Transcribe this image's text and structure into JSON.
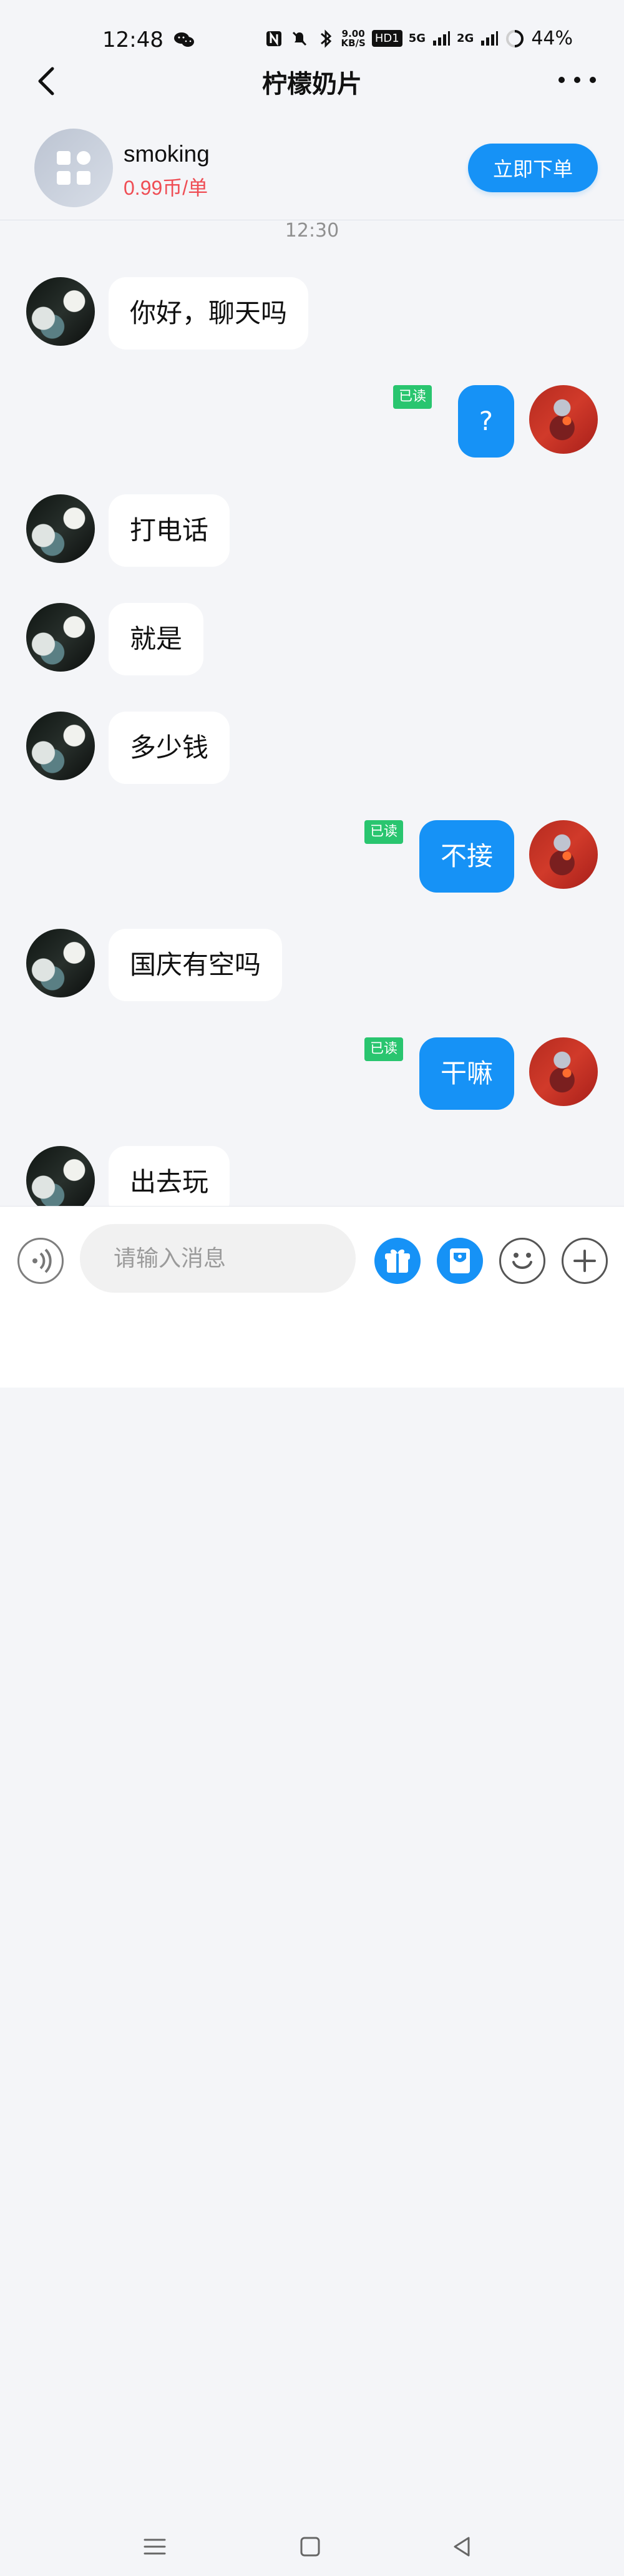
{
  "status": {
    "time": "12:48",
    "network_speed": "9.00",
    "network_unit": "KB/S",
    "hd": "HD1",
    "signal_1": "5G",
    "signal_2": "2G",
    "battery": "44%"
  },
  "header": {
    "title": "柠檬奶片"
  },
  "order": {
    "name": "smoking",
    "price": "0.99币/单",
    "button": "立即下单"
  },
  "chat": {
    "time": "12:30",
    "messages": [
      {
        "side": "left",
        "text": "你好，聊天吗"
      },
      {
        "side": "right",
        "text": "?",
        "read": "已读"
      },
      {
        "side": "left",
        "text": "打电话"
      },
      {
        "side": "left",
        "text": "就是"
      },
      {
        "side": "left",
        "text": "多少钱"
      },
      {
        "side": "right",
        "text": "不接",
        "read": "已读"
      },
      {
        "side": "left",
        "text": "国庆有空吗"
      },
      {
        "side": "right",
        "text": "干嘛",
        "read": "已读"
      },
      {
        "side": "left",
        "text": "出去玩"
      }
    ]
  },
  "input": {
    "placeholder": "请输入消息"
  },
  "icons": {
    "back": "back-arrow-icon",
    "more": "more-icon",
    "service": "apps-icon",
    "voice": "voice-icon",
    "gift": "gift-icon",
    "card": "card-icon",
    "emoji": "emoji-icon",
    "plus": "plus-icon",
    "menu": "menu-icon",
    "home": "home-icon",
    "back_nav": "back-nav-icon"
  },
  "colors": {
    "primary": "#1692f6",
    "price": "#ef4d54",
    "read_badge": "#29c56f",
    "background": "#f4f5f8"
  }
}
